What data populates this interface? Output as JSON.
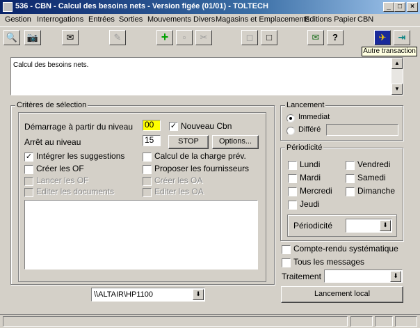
{
  "window": {
    "title": "536 - CBN - Calcul des besoins nets - Version figée (01/01) - TOLTECH",
    "minimize": "_",
    "maximize": "□",
    "close": "×"
  },
  "menu": [
    "Gestion",
    "Interrogations",
    "Entrées",
    "Sorties",
    "Mouvements Divers",
    "Magasins et Emplacements",
    "Editions Papier",
    "CBN"
  ],
  "toolbar": {
    "tooltip": "Autre transaction",
    "icons": [
      "🔍",
      "📷",
      "✉",
      "✎",
      "+",
      "▫",
      "✂",
      "◻",
      "□",
      "✉",
      "?",
      "✈",
      "⇥"
    ]
  },
  "description": {
    "text": "Calcul des besoins nets."
  },
  "criteres": {
    "title": "Critères de sélection",
    "demarrage_label": "Démarrage à partir du niveau",
    "demarrage_value": "00",
    "nouveau_cbn_label": "Nouveau Cbn",
    "arret_label": "Arrêt au niveau",
    "arret_value": "15",
    "stop_label": "STOP",
    "options_label": "Options...",
    "check_mark": "✓",
    "integrer_label": "Intégrer les suggestions",
    "calcul_charge_label": "Calcul de la charge prév.",
    "creer_of_label": "Créer les OF",
    "proposer_label": "Proposer les fournisseurs",
    "lancer_of_label": "Lancer les OF",
    "creer_oa_label": "Créer les OA",
    "editer_docs_label": "Editer les documents",
    "editer_oa_label": "Editer les OA"
  },
  "printer": {
    "value": "\\\\ALTAIR\\HP1100"
  },
  "lancement": {
    "title": "Lancement",
    "immediat": "Immediat",
    "differe": "Différé"
  },
  "periodicite": {
    "title": "Périodicité",
    "days": [
      "Lundi",
      "Mardi",
      "Mercredi",
      "Jeudi",
      "Vendredi",
      "Samedi",
      "Dimanche"
    ],
    "field_label": "Périodicité"
  },
  "options": {
    "compte_rendu": "Compte-rendu systématique",
    "tous_messages": "Tous les messages",
    "traitement_label": "Traitement",
    "lancement_local": "Lancement local"
  },
  "colors": {
    "title_gradient_start": "#0a246a",
    "title_gradient_end": "#a6caf0",
    "highlight_field": "#ffff00",
    "face": "#d4d0c8"
  }
}
